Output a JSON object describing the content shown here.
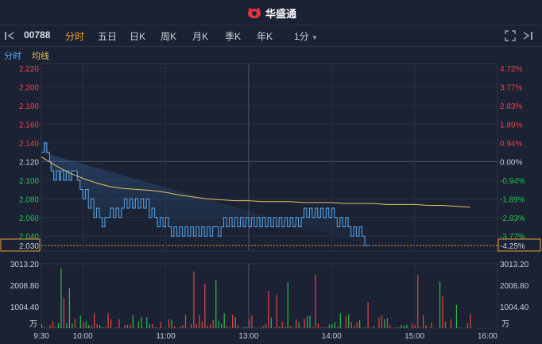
{
  "brand": {
    "name": "华盛通",
    "logo": "bull-logo-icon"
  },
  "toolbar": {
    "code": "00788",
    "tabs": [
      "分时",
      "五日",
      "日K",
      "周K",
      "月K",
      "季K",
      "年K"
    ],
    "active_tab": "分时",
    "interval": "1分"
  },
  "subbar": {
    "tab1": "分时",
    "tab2": "均线"
  },
  "colors": {
    "price_line": "#5aaaf0",
    "avg_line": "#e8c060",
    "up": "#e84545",
    "down": "#2ebd4e",
    "accent": "#f0a030"
  },
  "chart_data": {
    "type": "line",
    "prev_close": 2.12,
    "last_price": 2.03,
    "last_change_pct": "-4.25%",
    "price_ticks": [
      "2.220",
      "2.200",
      "2.180",
      "2.160",
      "2.140",
      "2.120",
      "2.100",
      "2.080",
      "2.060",
      "2.040",
      "2.030"
    ],
    "price_tick_values": [
      2.22,
      2.2,
      2.18,
      2.16,
      2.14,
      2.12,
      2.1,
      2.08,
      2.06,
      2.04,
      2.03
    ],
    "pct_ticks": [
      "4.72%",
      "3.77%",
      "2.83%",
      "1.89%",
      "0.94%",
      "0.00%",
      "-0.94%",
      "-1.89%",
      "-2.83%",
      "-3.77%",
      "-4.25%"
    ],
    "ylim": [
      2.02,
      2.22
    ],
    "x_ticks": [
      "9:30",
      "10:00",
      "11:00",
      "13:00",
      "14:00",
      "15:00",
      "16:00"
    ],
    "x_tick_minutes": [
      0,
      30,
      90,
      150,
      210,
      270,
      330
    ],
    "total_minutes": 330,
    "price_series": {
      "minutes": [
        0,
        2,
        4,
        6,
        7,
        9,
        11,
        13,
        14,
        16,
        18,
        20,
        22,
        24,
        26,
        28,
        30,
        32,
        34,
        36,
        38,
        40,
        42,
        44,
        46,
        48,
        50,
        52,
        54,
        56,
        58,
        60,
        62,
        64,
        66,
        68,
        70,
        72,
        74,
        76,
        78,
        80,
        82,
        84,
        86,
        88,
        90,
        92,
        94,
        96,
        98,
        100,
        102,
        104,
        106,
        108,
        110,
        112,
        114,
        116,
        118,
        120,
        122,
        124,
        126,
        128,
        130,
        132,
        134,
        136,
        138,
        140,
        142,
        144,
        146,
        148,
        150,
        152,
        154,
        156,
        158,
        160,
        162,
        164,
        166,
        168,
        170,
        172,
        174,
        176,
        178,
        180,
        182,
        184,
        186,
        188,
        190,
        192,
        194,
        196,
        198,
        200,
        202,
        204,
        206,
        208,
        210,
        212,
        214,
        216,
        218,
        220,
        222,
        224,
        226,
        228,
        230,
        232,
        234,
        236,
        238,
        240,
        242,
        244,
        246,
        248,
        250,
        252,
        254,
        256,
        258,
        260,
        262,
        264,
        266,
        268,
        270,
        272,
        274,
        276,
        278,
        280,
        282,
        284,
        286,
        288,
        290,
        292,
        294,
        296,
        298,
        300,
        302,
        304,
        306,
        308,
        310
      ],
      "values": [
        2.13,
        2.14,
        2.13,
        2.12,
        2.11,
        2.1,
        2.11,
        2.1,
        2.11,
        2.1,
        2.11,
        2.1,
        2.11,
        2.11,
        2.1,
        2.09,
        2.08,
        2.09,
        2.07,
        2.08,
        2.06,
        2.07,
        2.06,
        2.05,
        2.06,
        2.06,
        2.07,
        2.06,
        2.07,
        2.06,
        2.07,
        2.08,
        2.07,
        2.08,
        2.07,
        2.08,
        2.07,
        2.08,
        2.07,
        2.08,
        2.06,
        2.07,
        2.06,
        2.05,
        2.06,
        2.05,
        2.06,
        2.05,
        2.04,
        2.05,
        2.04,
        2.05,
        2.04,
        2.05,
        2.04,
        2.05,
        2.04,
        2.05,
        2.04,
        2.05,
        2.04,
        2.05,
        2.04,
        2.05,
        2.05,
        2.04,
        2.05,
        2.06,
        2.05,
        2.06,
        2.05,
        2.06,
        2.05,
        2.06,
        2.05,
        2.06,
        2.05,
        2.06,
        2.05,
        2.06,
        2.05,
        2.06,
        2.05,
        2.06,
        2.05,
        2.06,
        2.05,
        2.06,
        2.05,
        2.06,
        2.05,
        2.06,
        2.05,
        2.06,
        2.05,
        2.06,
        2.07,
        2.06,
        2.07,
        2.06,
        2.07,
        2.06,
        2.07,
        2.06,
        2.07,
        2.06,
        2.07,
        2.06,
        2.05,
        2.06,
        2.05,
        2.06,
        2.05,
        2.04,
        2.05,
        2.04,
        2.05,
        2.04,
        2.03,
        2.03
      ],
      "name": ""
    },
    "avg_series": {
      "minutes": [
        0,
        10,
        20,
        30,
        40,
        50,
        60,
        70,
        80,
        90,
        100,
        110,
        120,
        130,
        140,
        150,
        160,
        170,
        180,
        190,
        200,
        210,
        220,
        230,
        240,
        250,
        260,
        270,
        280,
        290,
        300,
        310
      ],
      "values": [
        2.125,
        2.116,
        2.108,
        2.102,
        2.097,
        2.093,
        2.091,
        2.09,
        2.089,
        2.087,
        2.084,
        2.082,
        2.08,
        2.079,
        2.078,
        2.078,
        2.077,
        2.077,
        2.077,
        2.076,
        2.076,
        2.076,
        2.075,
        2.075,
        2.075,
        2.074,
        2.074,
        2.074,
        2.073,
        2.073,
        2.072,
        2.071
      ]
    },
    "volume": {
      "ticks": [
        "3013.20",
        "2008.80",
        "1004.40"
      ],
      "tick_values": [
        3013.2,
        2008.8,
        1004.4
      ],
      "max": 3013.2,
      "unit": "万"
    }
  }
}
